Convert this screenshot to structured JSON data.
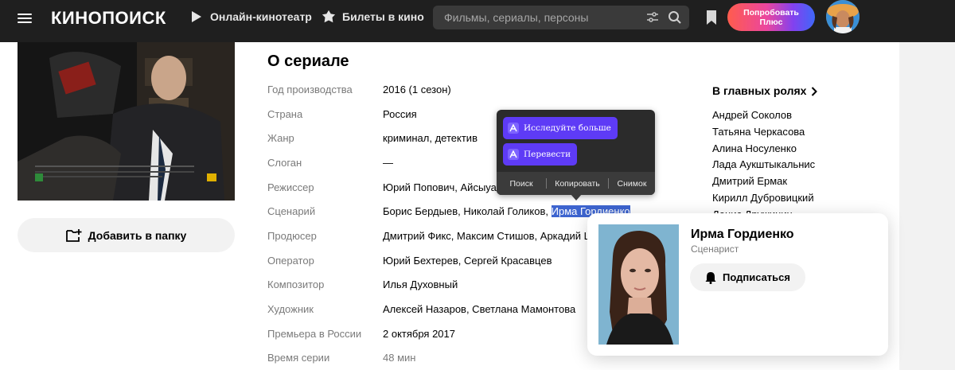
{
  "header": {
    "logo": "КИНОПОИСК",
    "nav": [
      {
        "label": "Онлайн-кинотеатр",
        "icon": "play-icon"
      },
      {
        "label": "Билеты в кино",
        "icon": "ticket-icon"
      }
    ],
    "search": {
      "placeholder": "Фильмы, сериалы, персоны",
      "value": ""
    },
    "plus_button": {
      "line1": "Попробовать",
      "line2": "Плюс"
    },
    "colors": {
      "bg": "#1f1f1f",
      "plus_gradient": [
        "#ff5c4d",
        "#eb469f",
        "#8341ef",
        "#3f68f9"
      ]
    }
  },
  "sidebar": {
    "add_folder_label": "Добавить в папку"
  },
  "about": {
    "title": "О сериале",
    "rows": [
      {
        "label": "Год производства",
        "value": "2016 (1 сезон)"
      },
      {
        "label": "Страна",
        "value": "Россия"
      },
      {
        "label": "Жанр",
        "value": "криминал, детектив"
      },
      {
        "label": "Слоган",
        "value": "—"
      },
      {
        "label": "Режиссер",
        "value": "Юрий Попович, Айсыуак"
      },
      {
        "label": "Сценарий",
        "value_prefix": "Борис Бердыев, Николай Голиков, ",
        "value_selected": "Ирма Гордиенко"
      },
      {
        "label": "Продюсер",
        "value": "Дмитрий Фикс, Максим Стишов, Аркадий Цим"
      },
      {
        "label": "Оператор",
        "value": "Юрий Бехтерев, Сергей Красавцев"
      },
      {
        "label": "Композитор",
        "value": "Илья Духовный"
      },
      {
        "label": "Художник",
        "value": "Алексей Назаров, Светлана Мамонтова"
      },
      {
        "label": "Премьера в России",
        "value": "2 октября 2017"
      },
      {
        "label": "Время серии",
        "value": "48 мин"
      }
    ]
  },
  "cast": {
    "title": "В главных ролях",
    "items": [
      "Андрей Соколов",
      "Татьяна Черкасова",
      "Алина Носуленко",
      "Лада Аукштыкальнис",
      "Дмитрий Ермак",
      "Кирилл Дубровицкий",
      "Денис Дружинин"
    ]
  },
  "context_menu": {
    "explore": "Исследуйте больше",
    "translate": "Перевести",
    "actions": [
      "Поиск",
      "Копировать",
      "Снимок"
    ],
    "accent": "#5e3bf6"
  },
  "person_card": {
    "name": "Ирма Гордиенко",
    "role": "Сценарист",
    "subscribe_label": "Подписаться"
  }
}
